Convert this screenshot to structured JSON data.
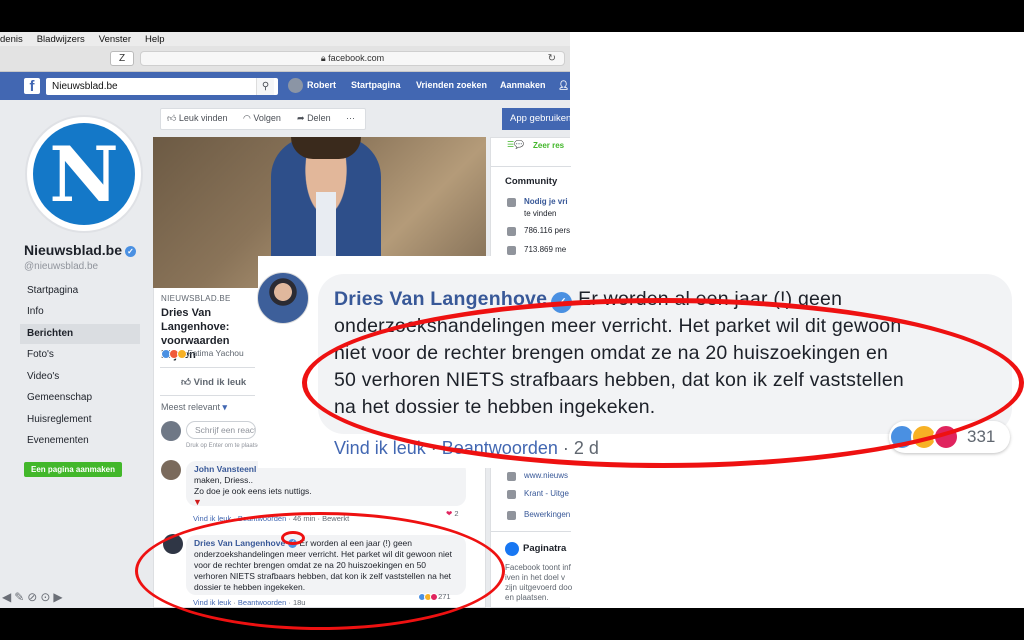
{
  "menubar": [
    "denis",
    "Bladwijzers",
    "Venster",
    "Help"
  ],
  "browser": {
    "z_label": "Z",
    "url": "facebook.com",
    "lock_icon": "lock-icon",
    "reload_icon": "reload-icon"
  },
  "fbnav": {
    "search_value": "Nieuwsblad.be",
    "user": "Robert",
    "items": [
      "Startpagina",
      "Vrienden zoeken",
      "Aanmaken"
    ]
  },
  "page": {
    "name": "Nieuwsblad.be",
    "handle": "@nieuwsblad.be",
    "logo_letter": "N",
    "nav": [
      "Startpagina",
      "Info",
      "Berichten",
      "Foto's",
      "Video's",
      "Gemeenschap",
      "Huisreglement",
      "Evenementen"
    ],
    "active_nav": "Berichten",
    "create_button": "Een pagina aanmaken"
  },
  "actions": {
    "like": "Leuk vinden",
    "follow": "Volgen",
    "share": "Delen",
    "more": "···",
    "app_button": "App gebruiken"
  },
  "post": {
    "source": "NIEUWSBLAD.BE",
    "title": "Dries Van Langenhove: voorwaarden blijven",
    "reacted_by": "Fatima Yachou",
    "like_button": "Vind ik leuk",
    "sort_label": "Meest relevant",
    "write_placeholder": "Schrijf een reactie...",
    "enter_hint": "Druk op Enter om te plaatsen."
  },
  "comments": [
    {
      "author": "John Vansteenl",
      "text_lines": [
        "maken, Driess..",
        "Zo doe je ook eens iets nuttigs."
      ],
      "reaction_count": "2",
      "meta": {
        "like": "Vind ik leuk",
        "reply": "Beantwoorden",
        "time": "46 min",
        "edited": "Bewerkt"
      }
    },
    {
      "author": "Dries Van Langenhove",
      "text": "Er worden al een jaar (!) geen onderzoekshandelingen meer verricht. Het parket wil dit gewoon niet voor de rechter brengen omdat ze na 20 huiszoekingen en 50 verhoren NIETS strafbaars hebben, dat kon ik zelf vaststellen na het dossier te hebben ingekeken.",
      "reaction_count": "271",
      "meta": {
        "like": "Vind ik leuk",
        "reply": "Beantwoorden",
        "time": "18u"
      }
    }
  ],
  "zoom": {
    "author": "Dries Van Langenhove",
    "lines": [
      "Er worden al een jaar (!) geen",
      "onderzoekshandelingen meer verricht. Het parket wil dit gewoon",
      "niet voor de rechter brengen omdat ze na 20 huiszoekingen en",
      "50 verhoren NIETS strafbaars hebben, dat kon ik zelf vaststellen",
      "na het dossier te hebben ingekeken."
    ],
    "like": "Vind ik leuk",
    "reply": "Beantwoorden",
    "time": "2 d",
    "reaction_count": "331"
  },
  "rightcol": {
    "response": "Zeer res",
    "community_title": "Community",
    "invite": "Nodig je vri",
    "invite_sub": "te vinden",
    "likes": "786.116 pers",
    "follows": "713.869 me",
    "website": "www.nieuws",
    "category": "Krant - Uitge",
    "edits": "Bewerkingen",
    "transparency_title": "Paginatra",
    "transparency_text": [
      "Facebook toont inf",
      "iven in het doel v",
      "zijn uitgevoerd doo",
      "en plaatsen."
    ]
  },
  "colors": {
    "fb_blue": "#4267b2",
    "link": "#385898",
    "annotation_red": "#ee1111",
    "green": "#42b72a"
  }
}
